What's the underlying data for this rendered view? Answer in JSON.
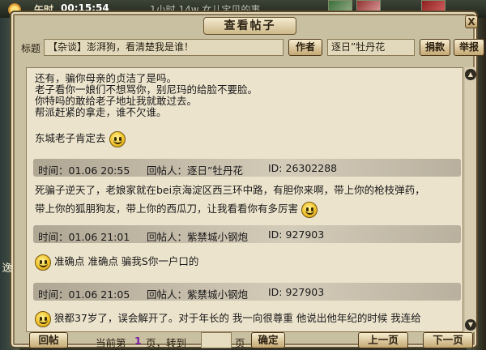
{
  "background": {
    "time_label": "午时",
    "clock": "00:15:54",
    "top_message": "1小时  14w  女儿宝贝的事"
  },
  "dialog": {
    "title": "查看帖子",
    "close": "X"
  },
  "header": {
    "title_label": "标题",
    "post_title": "【杂谈】澎湃狗，看清楚我是谁！",
    "author_button": "作者",
    "author_name": "逐日”牡丹花",
    "donate_button": "捐款",
    "report_button": "举报"
  },
  "posts": [
    {
      "lines": [
        "还有，骗你母亲的贞洁了是吗。",
        "老子看你一娘们不想骂你，别尼玛的给脸不要脸。",
        "你特吗的敢给老子地址我就敢过去。",
        "帮派赶紧的拿走，谁不欠谁。"
      ],
      "extra": "东城老子肯定去",
      "meta": {
        "time": "时间：01.06 20:55",
        "author": "回帖人：逐日”牡丹花",
        "id": "ID: 26302288"
      }
    },
    {
      "lines": [
        "死骗子逆天了，老娘家就在bei京海淀区西三环中路，有胆你来啊，带上你的枪枝弹药，",
        "带上你的狐朋狗友，带上你的西瓜刀，让我看看你有多厉害"
      ],
      "meta": {
        "time": "时间：01.06 21:01",
        "author": "回帖人：紫禁城小钢炮",
        "id": "ID: 927903"
      }
    },
    {
      "lines": [
        "准确点 准确点 骗我S你一户口的"
      ],
      "meta": {
        "time": "时间：01.06 21:05",
        "author": "回帖人：紫禁城小钢炮",
        "id": "ID: 927903"
      }
    },
    {
      "lines": [
        "狼都37岁了，误会解开了。对于年长的 我一向很尊重 他说出他年纪的时候 我连给"
      ]
    }
  ],
  "footer": {
    "reply_button": "回帖",
    "current_prefix": "当前第",
    "current_page": "1",
    "goto_text": "页，转到",
    "page_suffix": "页",
    "confirm_button": "确定",
    "prev_button": "上一页",
    "next_button": "下一页"
  },
  "colors": {
    "dialog_bg": "#c9c0a2",
    "content_bg": "#ece3cc",
    "meta_bar": "#c4baa8",
    "page_number": "#7a1ea0"
  },
  "icons": [
    "sun-icon",
    "smile-emoticon-icon",
    "scroll-up-icon",
    "scroll-down-icon",
    "close-icon"
  ]
}
